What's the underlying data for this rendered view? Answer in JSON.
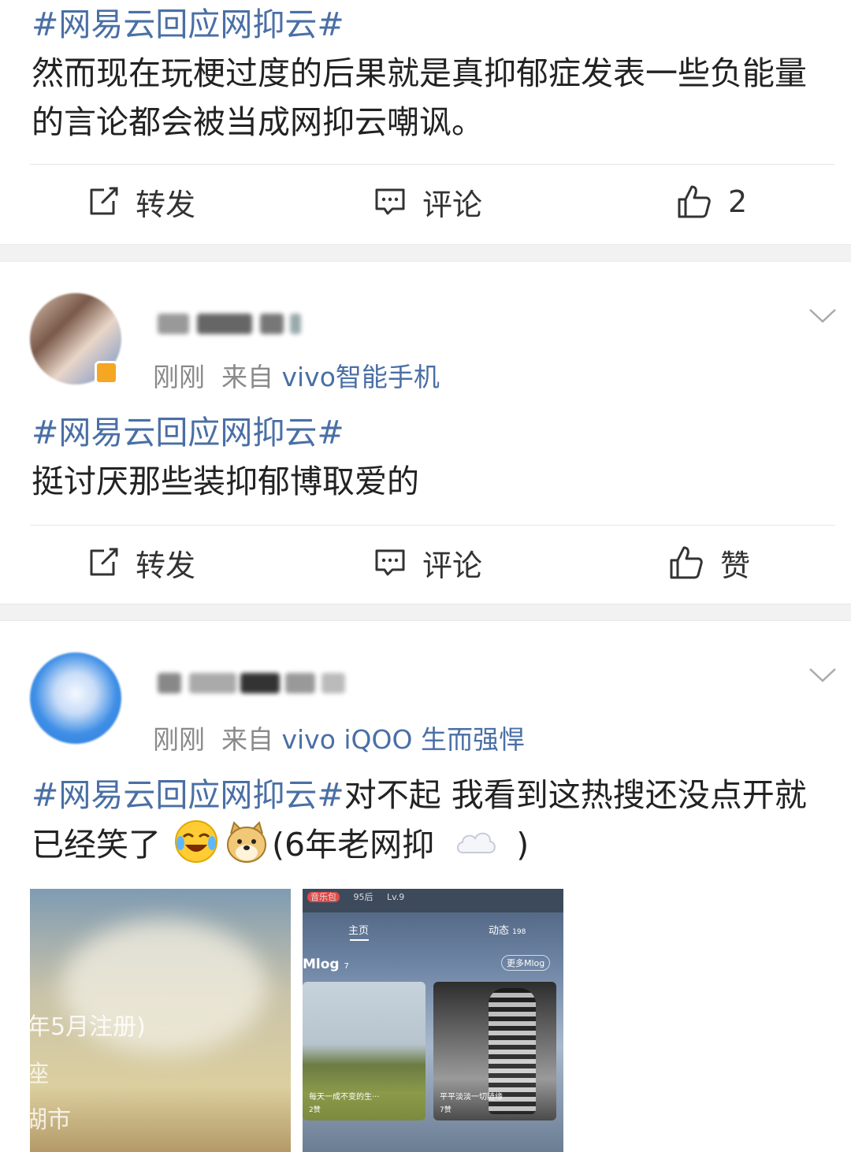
{
  "post1": {
    "topic": "#网易云回应网抑云#",
    "body": "然而现在玩梗过度的后果就是真抑郁症发表一些负能量的言论都会被当成网抑云嘲讽。",
    "actions": {
      "repost": "转发",
      "comment": "评论",
      "like": "2"
    }
  },
  "post2": {
    "time": "刚刚",
    "from_prefix": "来自",
    "source": "vivo智能手机",
    "topic": "#网易云回应网抑云#",
    "body": "挺讨厌那些装抑郁博取爱的",
    "actions": {
      "repost": "转发",
      "comment": "评论",
      "like": "赞"
    }
  },
  "post3": {
    "time": "刚刚",
    "from_prefix": "来自",
    "source": "vivo iQOO 生而强悍",
    "topic": "#网易云回应网抑云#",
    "body_a": "对不起  我看到这热搜还没点开就已经笑了",
    "body_b": "(6年老网抑",
    "body_c": ")",
    "emojis": [
      "laugh-cry-icon",
      "doge-icon",
      "cloud-icon"
    ],
    "image1": {
      "lines": [
        "年5月注册)",
        "座",
        "湖市"
      ]
    },
    "image2": {
      "tabs": [
        "主页",
        "动态"
      ],
      "tab2_count": "198",
      "section": "Mlog",
      "section_count": "7",
      "more": "更多Mlog",
      "card1_caption": "每天一成不变的生···",
      "card1_likes": "2赞",
      "card2_caption": "平平淡淡一切随缘",
      "card2_likes": "7赞",
      "top_badges": [
        "音乐包",
        "95后",
        "Lv.9"
      ]
    }
  },
  "colors": {
    "topic": "#4a6fa5",
    "separator": "#f2f2f2",
    "badge": "#f5a623"
  }
}
